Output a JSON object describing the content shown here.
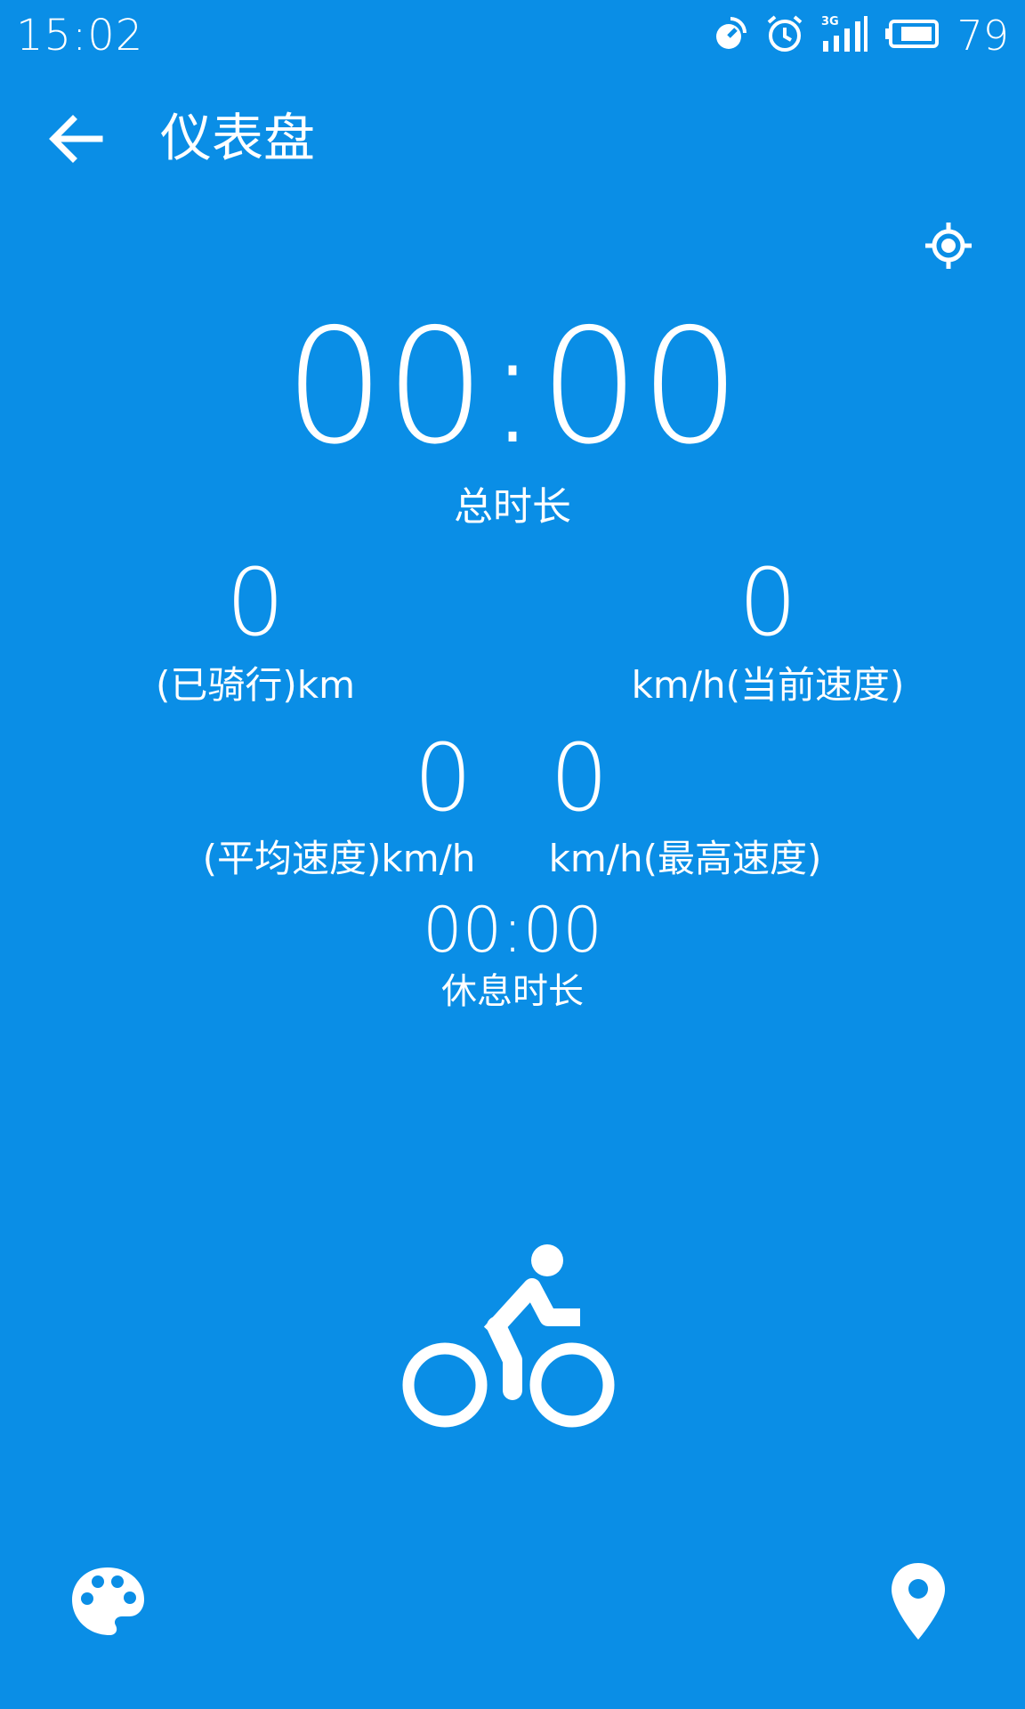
{
  "status_bar": {
    "time": "15:02",
    "icons": [
      "sync-icon",
      "alarm-icon",
      "signal-3g-icon",
      "battery-icon"
    ],
    "battery_level": "79"
  },
  "app_bar": {
    "back_icon": "back-arrow-icon",
    "title": "仪表盘",
    "locate_icon": "gps-locate-icon"
  },
  "metrics": {
    "total_duration": {
      "value": "00:00",
      "label": "总时长"
    },
    "distance": {
      "value": "0",
      "label": "(已骑行)km"
    },
    "current_speed": {
      "value": "0",
      "label": "km/h(当前速度)"
    },
    "average_speed": {
      "value": "0",
      "label": "(平均速度)km/h"
    },
    "max_speed": {
      "value": "0",
      "label": "km/h(最高速度)"
    },
    "rest_duration": {
      "value": "00:00",
      "label": "休息时长"
    }
  },
  "actions": {
    "start_icon": "bicycle-icon",
    "theme_icon": "palette-icon",
    "map_icon": "location-pin-icon"
  },
  "colors": {
    "background": "#0a8ee6",
    "foreground": "#ffffff"
  }
}
